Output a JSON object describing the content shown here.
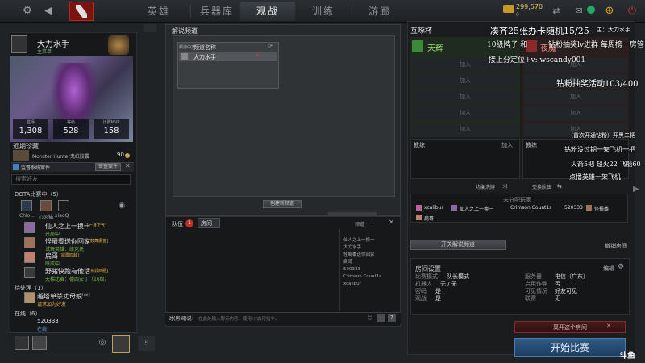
{
  "nav": {
    "tabs": [
      "英雄",
      "兵器库",
      "观战",
      "训练",
      "游廊"
    ],
    "active_tab": "观战",
    "currency": "299,570",
    "currency_sub": "0",
    "accent": "#b4271c"
  },
  "profile": {
    "name": "大力水手",
    "status": "主菜单",
    "stats": [
      {
        "label": "胜场",
        "value": "1,308"
      },
      {
        "label": "等级",
        "value": "528"
      },
      {
        "label": "比赛MVP",
        "value": "158"
      }
    ],
    "recent_title": "近期珍藏",
    "recent_item": "Monster Hunter鬼纸胶囊",
    "recent_count": "90",
    "notice": "监督系统案件",
    "notice_btn": "审查案件",
    "search_placeholder": "搜索好友"
  },
  "friends": {
    "in_game_header": "DOTA比赛中（5）",
    "in_game_avatars": [
      {
        "name": "Chlo..."
      },
      {
        "name": "心火猫"
      },
      {
        "name": "xiaoQ"
      }
    ],
    "in_game_list": [
      {
        "name": "仙人之上一换一",
        "tag": "[一身正气]",
        "sub": "开局中"
      },
      {
        "name": "怪蜀黍送你回家",
        "tag": "[鼓舞振奋]",
        "sub": "试玩英雄：维克托"
      },
      {
        "name": "扁哥",
        "tag": "[威震四敌]",
        "sub": "既成中"
      },
      {
        "name": "野猪快跑有他活",
        "tag": "[东郭西瓶]",
        "sub": "天梯比赛：德西安丁（16级）"
      }
    ],
    "pending_header": "待处理（1）",
    "pending": {
      "name": "越塔单杀丈母娘",
      "tag": "[hai]",
      "sub": "请求加为好友"
    },
    "online_header": "在线（6）",
    "online": {
      "name": "520333",
      "sub": "在线"
    }
  },
  "channel": {
    "title": "解说频道",
    "col_lang": "频道中文",
    "col_name": "频道名称",
    "row_name": "大力水手",
    "create_btn": "创建新频道"
  },
  "chat": {
    "tab_team": "队伍",
    "badge": "1",
    "tab_room": "房间",
    "channel_label": "频道",
    "members": [
      "仙人之上一换一",
      "大力水手",
      "怪蜀黍送你回家",
      "扁哥",
      "520333",
      "Crimson Couat1s",
      "xcalibur"
    ],
    "input_label": "对(房间)说：",
    "input_placeholder": "在此处输入聊天内容。使用\"/\"启用指令。"
  },
  "lobby": {
    "title": "互啄杯",
    "radiant": "天辉",
    "dire": "夜魇",
    "join": "加入",
    "coach": "教练",
    "shuffle_btn": "均衡洗牌",
    "swap_btn": "交换队伍",
    "unassigned_title": "未分配玩家",
    "unassigned": [
      "xcalibur",
      "仙人之上一换一",
      "Crimson Couat1s",
      "520333",
      "怪蜀黍",
      "扁哥"
    ],
    "broadcast_btn": "开关解说频道",
    "cancel_broadcast": "撤销房间",
    "settings_title": "房间设置",
    "edit_btn": "编辑",
    "settings_left": [
      {
        "k": "比赛模式",
        "v": "队长模式"
      },
      {
        "k": "机器人",
        "v": "无 / 无"
      },
      {
        "k": "密码",
        "v": "是"
      },
      {
        "k": "观战",
        "v": "是"
      }
    ],
    "settings_right": [
      {
        "k": "服务器",
        "v": "电信（广东）"
      },
      {
        "k": "启用作弊",
        "v": "否"
      },
      {
        "k": "可见情况",
        "v": "好友可见"
      },
      {
        "k": "联赛",
        "v": "无"
      }
    ],
    "leave_btn": "离开这个房间",
    "start_btn": "开始比赛"
  },
  "overlay": {
    "line1": "凑齐25张办卡随机15/25",
    "line1b": "主：大力水手",
    "line2": "10级牌子 和",
    "line2b": "钻粉抽奖lv进群 每周榜一房管",
    "line3": "接上分定位+v: wscandy001",
    "line4": "钻粉抽奖活动103/400",
    "line5": "（首次开通钻粉）开黑二把",
    "line6": "钻粉没过期一架飞机一把",
    "line7": "火箭5把 超火22 飞船60",
    "line8": "点播英雄一架飞机"
  },
  "watermark": "斗鱼"
}
